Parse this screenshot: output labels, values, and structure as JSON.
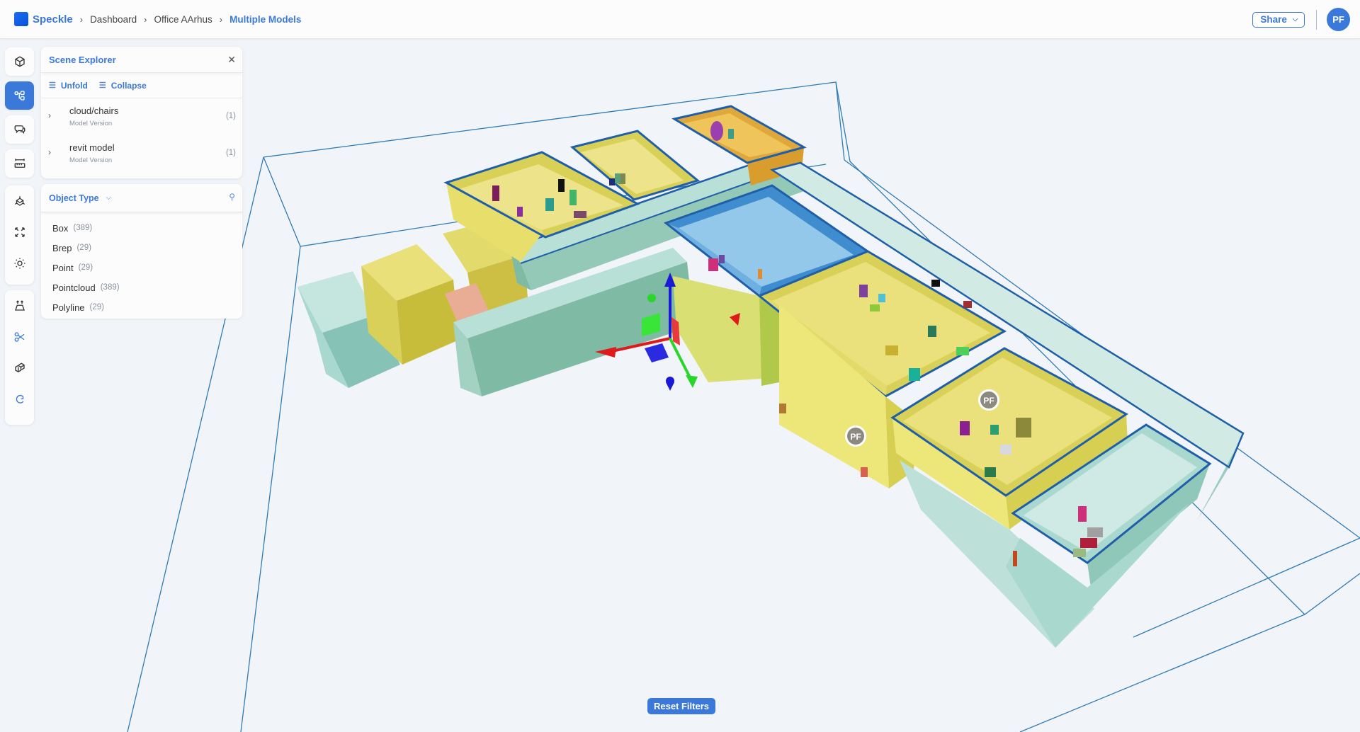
{
  "header": {
    "brand": "Speckle",
    "breadcrumbs": [
      "Dashboard",
      "Office AArhus",
      "Multiple Models"
    ],
    "share_label": "Share",
    "avatar_initials": "PF"
  },
  "toolbar": {
    "groups": [
      [
        "models",
        "scene-explorer",
        "discussions",
        "measure"
      ],
      [
        "view-modes",
        "zoom-extents",
        "lighting"
      ],
      [
        "explode",
        "section-box",
        "view-compare",
        "reset"
      ]
    ],
    "active": "scene-explorer"
  },
  "scene_explorer": {
    "title": "Scene Explorer",
    "unfold_label": "Unfold",
    "collapse_label": "Collapse",
    "models": [
      {
        "name": "cloud/chairs",
        "type": "Model Version",
        "count": "(1)"
      },
      {
        "name": "revit model",
        "type": "Model Version",
        "count": "(1)"
      }
    ]
  },
  "filters": {
    "title": "Object Type",
    "items": [
      {
        "label": "Box",
        "count": "(389)"
      },
      {
        "label": "Brep",
        "count": "(29)"
      },
      {
        "label": "Point",
        "count": "(29)"
      },
      {
        "label": "Pointcloud",
        "count": "(389)"
      },
      {
        "label": "Polyline",
        "count": "(29)"
      }
    ]
  },
  "viewport": {
    "user_markers": [
      "PF",
      "PF"
    ],
    "colors": {
      "accent": "#3a79da",
      "yellow_room": "#e8e06f",
      "teal_block": "#a9d8cf",
      "blue_room": "#8cc5e8",
      "orange_room": "#e6b445",
      "salmon_block": "#e9ad95",
      "bbox_line": "#2f7bb5"
    }
  },
  "reset_filters_label": "Reset Filters"
}
